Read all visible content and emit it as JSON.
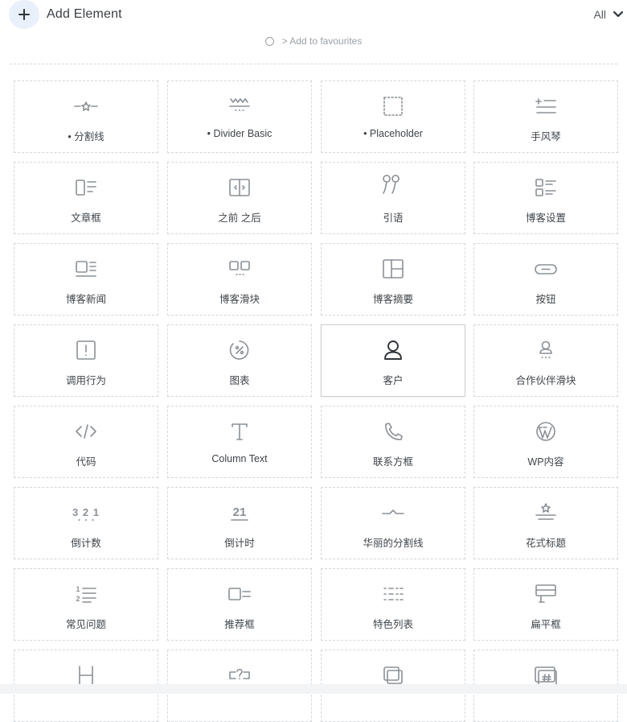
{
  "header": {
    "title": "Add Element",
    "filter_label": "All"
  },
  "favourites": {
    "label": "> Add to favourites"
  },
  "elements": [
    {
      "label": "• 分割线",
      "icon": "divider-star-icon"
    },
    {
      "label": "• Divider Basic",
      "icon": "divider-basic-icon"
    },
    {
      "label": "• Placeholder",
      "icon": "placeholder-icon"
    },
    {
      "label": "手风琴",
      "icon": "accordion-icon"
    },
    {
      "label": "文章框",
      "icon": "article-box-icon"
    },
    {
      "label": "之前 之后",
      "icon": "before-after-icon"
    },
    {
      "label": "引语",
      "icon": "quote-icon"
    },
    {
      "label": "博客设置",
      "icon": "blog-settings-icon"
    },
    {
      "label": "博客新闻",
      "icon": "blog-news-icon"
    },
    {
      "label": "博客滑块",
      "icon": "blog-slider-icon"
    },
    {
      "label": "博客摘要",
      "icon": "blog-teaser-icon"
    },
    {
      "label": "按钮",
      "icon": "button-icon"
    },
    {
      "label": "调用行为",
      "icon": "call-to-action-icon"
    },
    {
      "label": "图表",
      "icon": "chart-icon"
    },
    {
      "label": "客户",
      "icon": "client-icon"
    },
    {
      "label": "合作伙伴滑块",
      "icon": "partner-slider-icon"
    },
    {
      "label": "代码",
      "icon": "code-icon"
    },
    {
      "label": "Column Text",
      "icon": "column-text-icon"
    },
    {
      "label": "联系方框",
      "icon": "phone-icon"
    },
    {
      "label": "WP内容",
      "icon": "wordpress-icon"
    },
    {
      "label": "倒计数",
      "icon": "counter-icon"
    },
    {
      "label": "倒计时",
      "icon": "countdown-icon"
    },
    {
      "label": "华丽的分割线",
      "icon": "fancy-divider-icon"
    },
    {
      "label": "花式标题",
      "icon": "fancy-heading-icon"
    },
    {
      "label": "常见问题",
      "icon": "faq-icon"
    },
    {
      "label": "推荐框",
      "icon": "feature-box-icon"
    },
    {
      "label": "特色列表",
      "icon": "feature-list-icon"
    },
    {
      "label": "扁平框",
      "icon": "flat-box-icon"
    },
    {
      "label": "",
      "icon": "heading-icon"
    },
    {
      "label": "",
      "icon": "hotspot-icon"
    },
    {
      "label": "",
      "icon": "image-gallery-icon"
    },
    {
      "label": "",
      "icon": "hashtag-box-icon"
    }
  ],
  "active_index": 14,
  "colors": {
    "icon": "#8a9096",
    "active_icon": "#2f343a",
    "add_bg": "#e8f0fb"
  }
}
